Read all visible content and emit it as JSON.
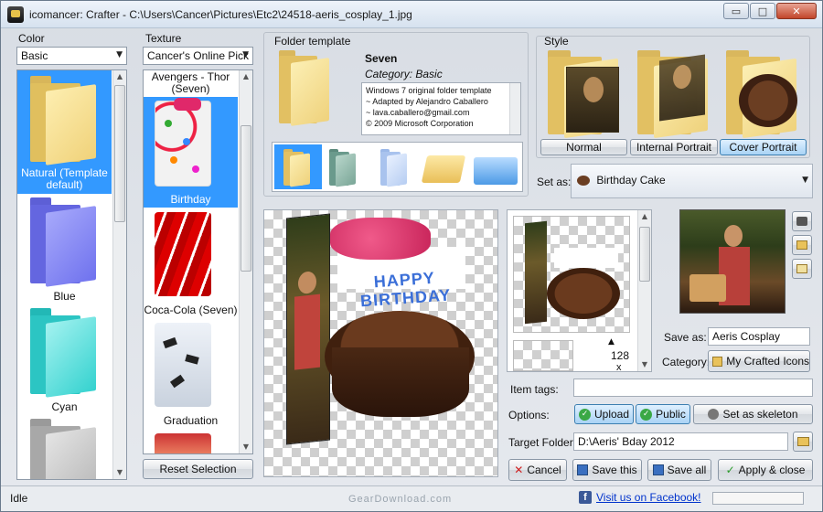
{
  "window": {
    "title": "icomancer: Crafter - C:\\Users\\Cancer\\Pictures\\Etc2\\24518-aeris_cosplay_1.jpg",
    "minimize": "▭",
    "maximize": "□",
    "close": "✕"
  },
  "color_panel": {
    "label": "Color",
    "dropdown_value": "Basic",
    "items": [
      {
        "label": "Natural (Template default)",
        "color": "#f2d77a"
      },
      {
        "label": "Blue",
        "color": "#7b7ef0"
      },
      {
        "label": "Cyan",
        "color": "#3fd6d4"
      },
      {
        "label": "",
        "color": "#b9b9b9"
      }
    ]
  },
  "texture_panel": {
    "label": "Texture",
    "dropdown_value": "Cancer's Online Pick",
    "items": [
      {
        "label": "Avengers - Thor (Seven)"
      },
      {
        "label": "Birthday"
      },
      {
        "label": "Coca-Cola (Seven)"
      },
      {
        "label": "Graduation"
      }
    ],
    "reset_button": "Reset Selection"
  },
  "folder_template": {
    "label": "Folder template",
    "name": "Seven",
    "category": "Category: Basic",
    "description": "Windows 7 original folder template\n~ Adapted by Alejandro Caballero\n~ lava.caballero@gmail.com\n© 2009 Microsoft Corporation"
  },
  "style_panel": {
    "label": "Style",
    "buttons": [
      "Normal",
      "Internal Portrait",
      "Cover Portrait"
    ],
    "set_as_label": "Set as:",
    "set_as_value": "Birthday Cake"
  },
  "thumb_strip": {
    "size_label": "128",
    "size_unit": "x"
  },
  "form": {
    "save_as_label": "Save as:",
    "save_as_value": "Aeris Cosplay",
    "category_label": "Category:",
    "category_value": "My Crafted Icons",
    "item_tags_label": "Item tags:",
    "item_tags_value": "",
    "options_label": "Options:",
    "upload": "Upload",
    "public": "Public",
    "skeleton": "Set as skeleton",
    "target_folder_label": "Target Folder:",
    "target_folder_value": "D:\\Aeris' Bday 2012"
  },
  "actions": {
    "cancel": "Cancel",
    "save_this": "Save this",
    "save_all": "Save all",
    "apply_close": "Apply & close"
  },
  "preview": {
    "candles_text": "HAPPY BIRTHDAY"
  },
  "statusbar": {
    "status": "Idle",
    "facebook_link": "Visit us on Facebook!",
    "facebook_icon": "f",
    "watermark": "GearDownload.com"
  },
  "colors": {
    "selection": "#3399ff",
    "accent_blue": "#3c7fb1"
  }
}
